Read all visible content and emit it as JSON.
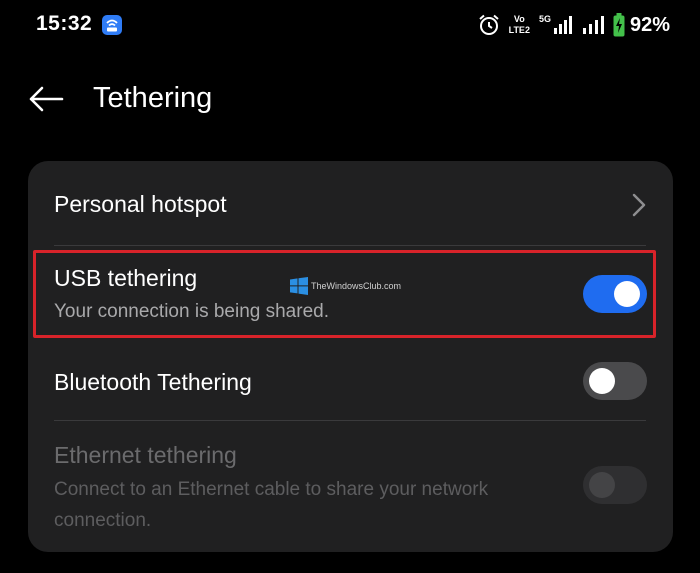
{
  "status_bar": {
    "time": "15:32",
    "network_labels": {
      "volte_top": "Vo",
      "volte_bottom": "LTE2",
      "signal_5g": "5G"
    },
    "battery_percent": "92%",
    "icons": [
      "hotspot-app-icon",
      "alarm-icon",
      "volte-icon",
      "signal-icon",
      "battery-charging-icon"
    ]
  },
  "header": {
    "title": "Tethering",
    "back_icon": "back-arrow-icon"
  },
  "settings": {
    "personal_hotspot": {
      "title": "Personal hotspot",
      "icon": "chevron-right-icon"
    },
    "usb_tethering": {
      "title": "USB tethering",
      "subtitle": "Your connection is being shared.",
      "enabled": true
    },
    "bluetooth_tethering": {
      "title": "Bluetooth Tethering",
      "enabled": false
    },
    "ethernet_tethering": {
      "title": "Ethernet tethering",
      "subtitle": "Connect to an Ethernet cable to share your network connection.",
      "enabled": false,
      "disabled": true
    }
  },
  "watermark": {
    "text": "TheWindowsClub.com"
  },
  "colors": {
    "background": "#000000",
    "card": "#202021",
    "toggle_on": "#1f6cf0",
    "toggle_off": "#4a4a4c",
    "highlight": "#d8232a",
    "subtitle": "#a9a9ab"
  }
}
